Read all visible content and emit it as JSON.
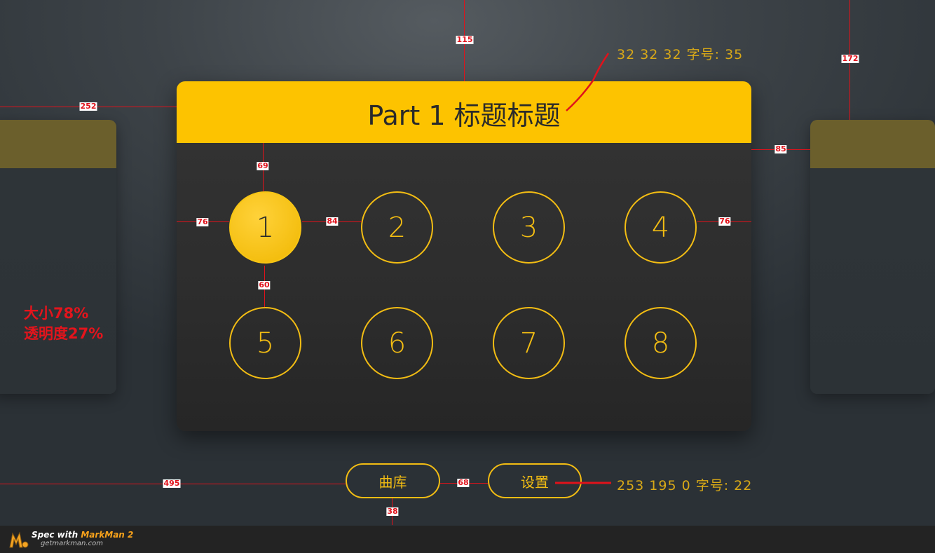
{
  "main_card": {
    "title": "Part 1 标题标题",
    "levels": [
      {
        "label": "1",
        "active": true
      },
      {
        "label": "2",
        "active": false
      },
      {
        "label": "3",
        "active": false
      },
      {
        "label": "4",
        "active": false
      },
      {
        "label": "5",
        "active": false
      },
      {
        "label": "6",
        "active": false
      },
      {
        "label": "7",
        "active": false
      },
      {
        "label": "8",
        "active": false
      }
    ]
  },
  "bottom_buttons": {
    "library_label": "曲库",
    "settings_label": "设置"
  },
  "annotations": {
    "title_color_note": "32 32 32  字号: 35",
    "button_color_note": "253 195 0  字号: 22",
    "side_card_note_line1": "大小78%",
    "side_card_note_line2": "透明度27%",
    "dim_252": "252",
    "dim_115": "115",
    "dim_172": "172",
    "dim_85": "85",
    "dim_69": "69",
    "dim_76_left": "76",
    "dim_84": "84",
    "dim_76_right": "76",
    "dim_60": "60",
    "dim_495": "495",
    "dim_68": "68",
    "dim_38": "38"
  },
  "footer": {
    "brand_prefix": "Spec with ",
    "brand_name": "MarkMan 2",
    "url": "getmarkman.com"
  },
  "colors": {
    "accent_yellow": "#fdc300",
    "title_text": "#202020",
    "annotation_red": "#e0121b"
  }
}
